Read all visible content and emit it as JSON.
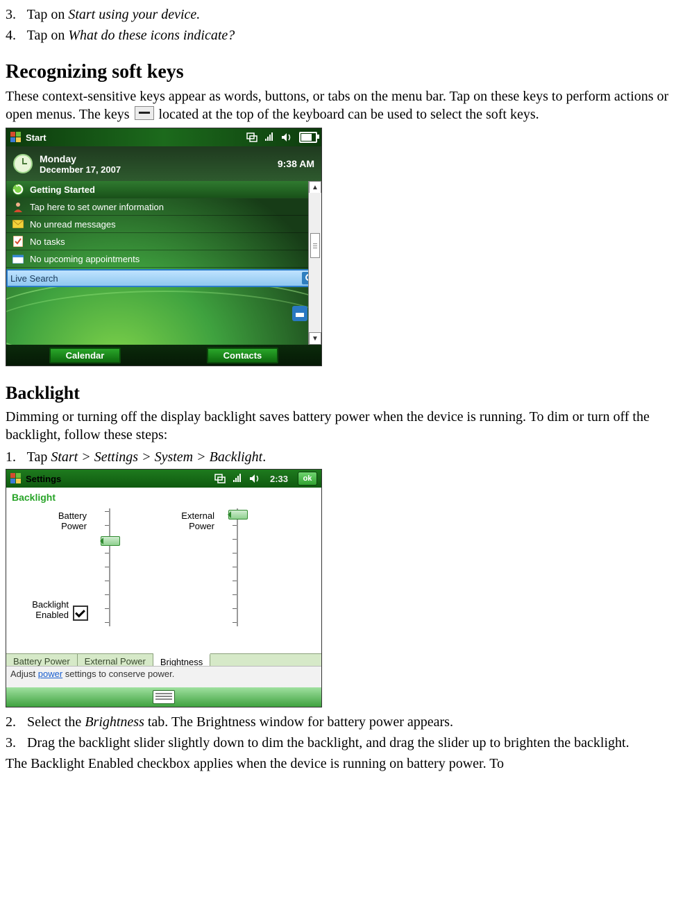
{
  "steps_a": [
    {
      "n": "3.",
      "pre": "Tap on ",
      "em": "Start using your device."
    },
    {
      "n": "4.",
      "pre": "Tap on ",
      "em": "What do these icons indicate?"
    }
  ],
  "h_softkeys": "Recognizing soft keys",
  "p_softkeys_a": "These context-sensitive keys appear as words, buttons, or tabs on the menu bar. Tap on these keys to perform actions or open menus. The keys ",
  "p_softkeys_b": " located at the top of the keyboard can be used to select the soft keys.",
  "shot1": {
    "title": "Start",
    "day": "Monday",
    "date": "December 17, 2007",
    "time": "9:38 AM",
    "gs": "Getting Started",
    "rows": [
      "Tap here to set owner information",
      "No unread messages",
      "No tasks",
      "No upcoming appointments"
    ],
    "live": "Live Search",
    "sk_left": "Calendar",
    "sk_right": "Contacts"
  },
  "h_backlight": "Backlight",
  "p_backlight": "Dimming or turning off the display backlight saves battery power when the device is running. To dim or turn off the backlight, follow these steps:",
  "step_b1": {
    "n": "1.",
    "pre": "Tap ",
    "em": "Start > Settings > System > Backlight",
    "post": "."
  },
  "shot2": {
    "title": "Settings",
    "time": "2:33",
    "ok": "ok",
    "heading": "Backlight",
    "lbl_batt": "Battery Power",
    "lbl_ext": "External Power",
    "lbl_be": "Backlight Enabled",
    "tabs": [
      "Battery Power",
      "External Power",
      "Brightness"
    ],
    "active_tab": 2,
    "hint_a": "Adjust ",
    "hint_link": "power",
    "hint_b": " settings to conserve power."
  },
  "steps_c": [
    {
      "n": "2.",
      "pre": "Select the ",
      "em": "Brightness",
      "post": " tab. The Brightness window for battery power appears."
    },
    {
      "n": "3.",
      "pre": "Drag the backlight slider slightly down to dim the backlight, and drag the slider up to brighten the backlight.",
      "em": "",
      "post": ""
    }
  ],
  "p_tail": "The Backlight Enabled checkbox applies when the device is running on battery power. To"
}
